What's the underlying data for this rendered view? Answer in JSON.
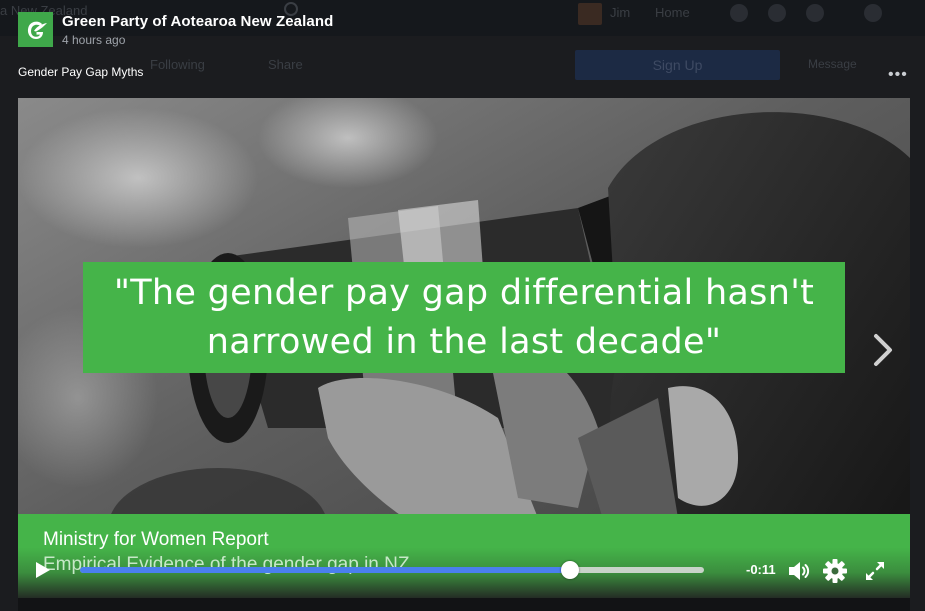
{
  "background": {
    "search_text": "a New Zealand",
    "user_name": "Jim",
    "nav_home": "Home",
    "following_label": "Following",
    "share_label": "Share",
    "signup_label": "Sign Up",
    "message_label": "Message"
  },
  "post": {
    "page_name": "Green Party of Aotearoa New Zealand",
    "time": "4 hours ago",
    "title": "Gender Pay Gap Myths",
    "more_icon": "more-dots-icon"
  },
  "video": {
    "quote_line1": "\"The gender pay gap differential hasn't",
    "quote_line2": "narrowed in the last decade\"",
    "caption_title": "Ministry for Women Report",
    "caption_subtitle": "Empirical Evidence of the gender gap in NZ",
    "time_remaining": "-0:11",
    "progress_fraction": 0.786
  },
  "colors": {
    "brand_green": "#45b449",
    "progress_blue": "#4a7fee"
  }
}
